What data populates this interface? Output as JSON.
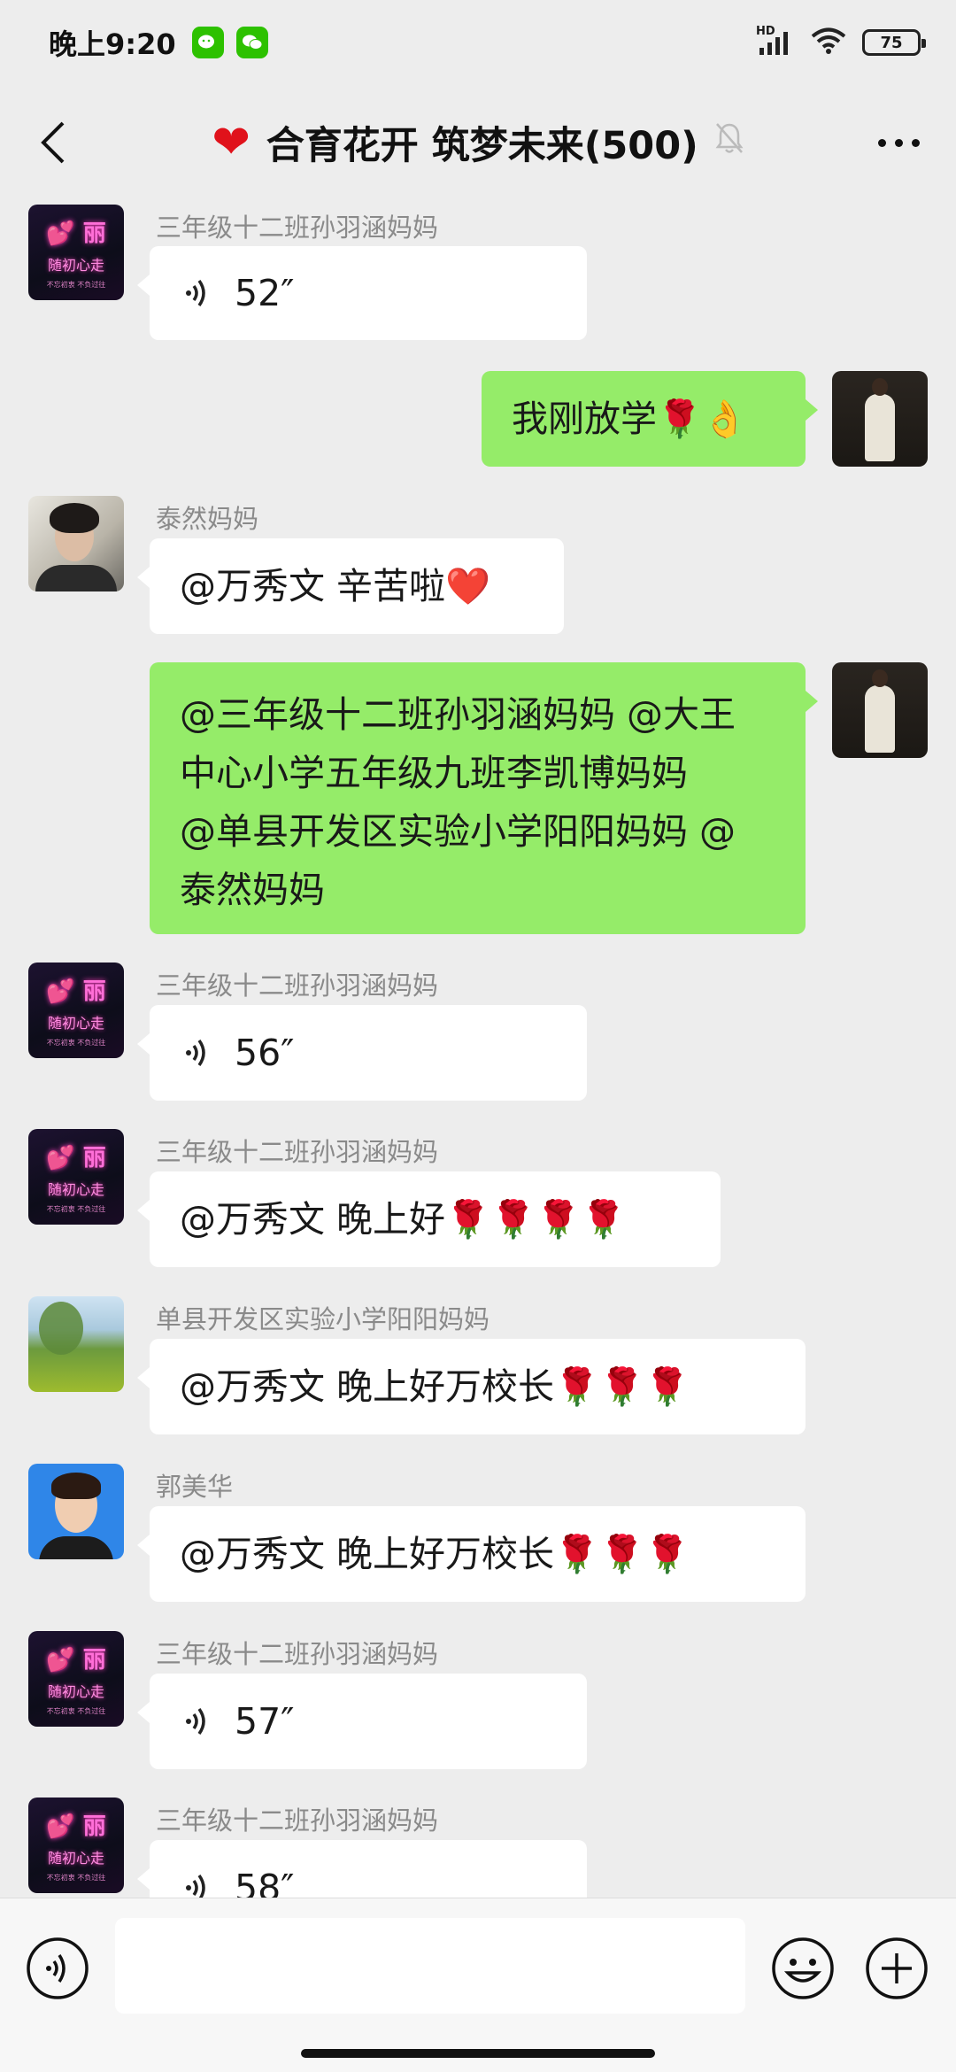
{
  "status_bar": {
    "time": "晚上9:20",
    "network": "HD",
    "battery": "75"
  },
  "header": {
    "title": "合育花开 筑梦未来(500)"
  },
  "messages": [
    {
      "sender": "三年级十二班孙羽涵妈妈",
      "type": "voice",
      "duration": "52″"
    },
    {
      "sender": "",
      "type": "text",
      "text": "我刚放学🌹👌"
    },
    {
      "sender": "泰然妈妈",
      "type": "text",
      "text": "@万秀文  辛苦啦❤️"
    },
    {
      "sender": "",
      "type": "text",
      "lines": [
        "@三年级十二班孙羽涵妈妈 @大王",
        "中心小学五年级九班李凯博妈妈",
        "@单县开发区实验小学阳阳妈妈 @",
        "泰然妈妈"
      ]
    },
    {
      "sender": "三年级十二班孙羽涵妈妈",
      "type": "voice",
      "duration": "56″"
    },
    {
      "sender": "三年级十二班孙羽涵妈妈",
      "type": "text",
      "text": "@万秀文  晚上好🌹🌹🌹🌹"
    },
    {
      "sender": "单县开发区实验小学阳阳妈妈",
      "type": "text",
      "text": "@万秀文  晚上好万校长🌹🌹🌹"
    },
    {
      "sender": "郭美华",
      "type": "text",
      "text": "@万秀文  晚上好万校长🌹🌹🌹"
    },
    {
      "sender": "三年级十二班孙羽涵妈妈",
      "type": "voice",
      "duration": "57″"
    },
    {
      "sender": "三年级十二班孙羽涵妈妈",
      "type": "voice",
      "duration": "58″"
    }
  ],
  "avatar_neon": {
    "line1": "💕 丽",
    "line2": "随初心走",
    "line3": "不忘初衷 不负过往"
  },
  "icons": {
    "back": "chevron-left-icon",
    "mute": "bell-off-icon",
    "more": "more-dots-icon",
    "voice": "voice-wave-icon",
    "emoji": "emoji-icon",
    "plus": "plus-circle-icon"
  },
  "colors": {
    "background": "#ededed",
    "outgoing_bubble": "#95ec69",
    "incoming_bubble": "#ffffff",
    "accent": "#2dc100"
  }
}
